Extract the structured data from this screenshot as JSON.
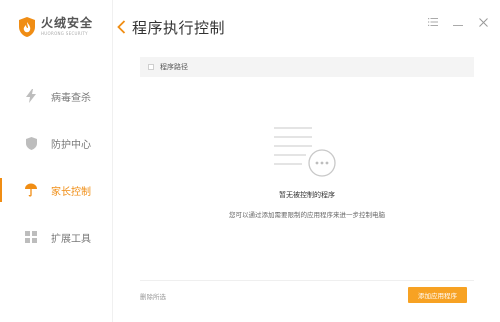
{
  "app": {
    "name": "火绒安全",
    "subtitle": "HUORONG SECURITY"
  },
  "sidebar": {
    "items": [
      {
        "label": "病毒查杀",
        "icon": "lightning-icon",
        "active": false
      },
      {
        "label": "防护中心",
        "icon": "shield-icon",
        "active": false
      },
      {
        "label": "家长控制",
        "icon": "umbrella-icon",
        "active": true
      },
      {
        "label": "扩展工具",
        "icon": "grid-icon",
        "active": false
      }
    ]
  },
  "header": {
    "title": "程序执行控制",
    "back_icon": "chevron-left-icon",
    "menu_icon": "menu-icon",
    "minimize_icon": "minimize-icon",
    "close_icon": "close-icon"
  },
  "table": {
    "columns": [
      "程序路径"
    ]
  },
  "empty_state": {
    "title": "暂无被控制的程序",
    "subtitle": "您可以通过添加需要限制的应用程序来进一步控制电脑"
  },
  "footer": {
    "delete_label": "删除所选",
    "add_label": "添加应用程序"
  },
  "colors": {
    "accent": "#f08d14",
    "button": "#f7a223"
  }
}
